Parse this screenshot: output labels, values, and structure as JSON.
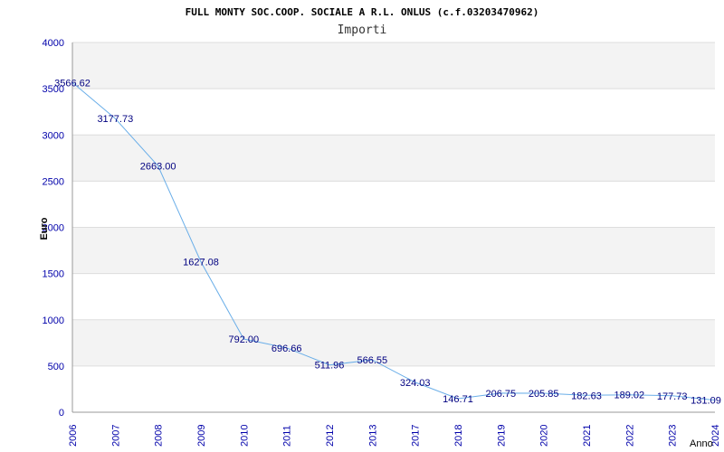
{
  "header": {
    "title": "FULL MONTY SOC.COOP. SOCIALE A R.L. ONLUS (c.f.03203470962)",
    "subtitle": "Importi"
  },
  "colors": {
    "line": "#6aaee8",
    "band": "#f3f3f3",
    "grid": "#dddddd",
    "axis": "#999999",
    "tick_text": "#0000aa",
    "label_text": "#000080"
  },
  "chart_data": {
    "type": "line",
    "title": "FULL MONTY SOC.COOP. SOCIALE A R.L. ONLUS (c.f.03203470962)",
    "subtitle": "Importi",
    "xlabel": "Anno",
    "ylabel": "Euro",
    "ylim": [
      0,
      4000
    ],
    "yticks": [
      0,
      500,
      1000,
      1500,
      2000,
      2500,
      3000,
      3500,
      4000
    ],
    "grid": true,
    "categories": [
      "2006",
      "2007",
      "2008",
      "2009",
      "2010",
      "2011",
      "2012",
      "2013",
      "2017",
      "2018",
      "2019",
      "2020",
      "2021",
      "2022",
      "2023",
      "2024"
    ],
    "series": [
      {
        "values": [
          3566.62,
          3177.73,
          2663.0,
          1627.08,
          792.0,
          696.66,
          511.96,
          566.55,
          324.03,
          146.71,
          206.75,
          205.85,
          182.63,
          189.02,
          177.73,
          131.09
        ],
        "labels": [
          "3566.62",
          "3177.73",
          "2663.00",
          "1627.08",
          "792.00",
          "696.66",
          "511.96",
          "566.55",
          "324.03",
          "146.71",
          "206.75",
          "205.85",
          "182.63",
          "189.02",
          "177.73",
          "131.09"
        ]
      }
    ]
  }
}
